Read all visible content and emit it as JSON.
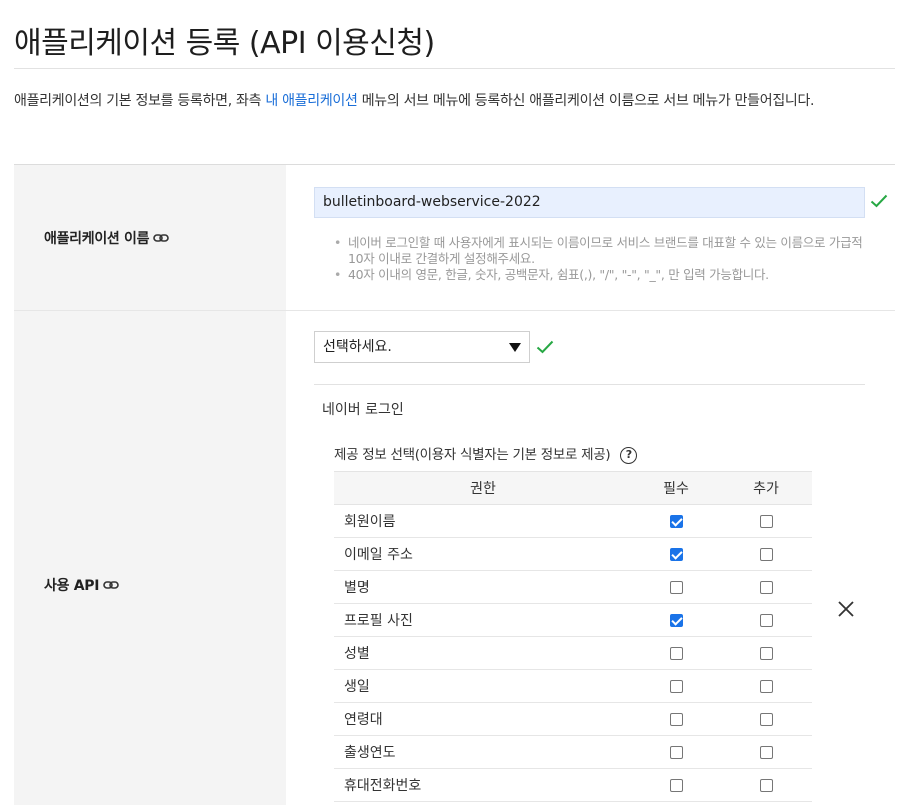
{
  "page": {
    "title": "애플리케이션 등록 (API 이용신청)",
    "intro_before": "애플리케이션의 기본 정보를 등록하면, 좌측 ",
    "intro_link": "내 애플리케이션",
    "intro_after": " 메뉴의 서브 메뉴에 등록하신 애플리케이션 이름으로 서브 메뉴가 만들어집니다."
  },
  "app_name": {
    "label": "애플리케이션 이름",
    "value": "bulletinboard-webservice-2022",
    "hints": [
      "네이버 로그인할 때 사용자에게 표시되는 이름이므로 서비스 브랜드를 대표할 수 있는 이름으로 가급적 10자 이내로 간결하게 설정해주세요.",
      "40자 이내의 영문, 한글, 숫자, 공백문자, 쉼표(,), \"/\", \"-\", \"_\", 만 입력 가능합니다."
    ]
  },
  "api": {
    "label": "사용 API",
    "select_value": "선택하세요.",
    "selected_api": "네이버 로그인",
    "scope_title": "제공 정보 선택(이용자 식별자는 기본 정보로 제공)",
    "help_symbol": "?",
    "columns": [
      "권한",
      "필수",
      "추가"
    ],
    "rows": [
      {
        "name": "회원이름",
        "required": true,
        "additional": false
      },
      {
        "name": "이메일 주소",
        "required": true,
        "additional": false
      },
      {
        "name": "별명",
        "required": false,
        "additional": false
      },
      {
        "name": "프로필 사진",
        "required": true,
        "additional": false
      },
      {
        "name": "성별",
        "required": false,
        "additional": false
      },
      {
        "name": "생일",
        "required": false,
        "additional": false
      },
      {
        "name": "연령대",
        "required": false,
        "additional": false
      },
      {
        "name": "출생연도",
        "required": false,
        "additional": false
      },
      {
        "name": "휴대전화번호",
        "required": false,
        "additional": false
      }
    ]
  },
  "colors": {
    "link": "#1a6ed8",
    "check": "#27a844",
    "checkbox_checked": "#1a73e8",
    "input_bg": "#e8f0fe",
    "label_bg": "#f4f4f4"
  },
  "icons": {
    "label_link": "link-icon",
    "valid": "check-icon",
    "dropdown": "triangle-down-icon",
    "help": "question-circle-icon",
    "remove": "close-icon"
  }
}
